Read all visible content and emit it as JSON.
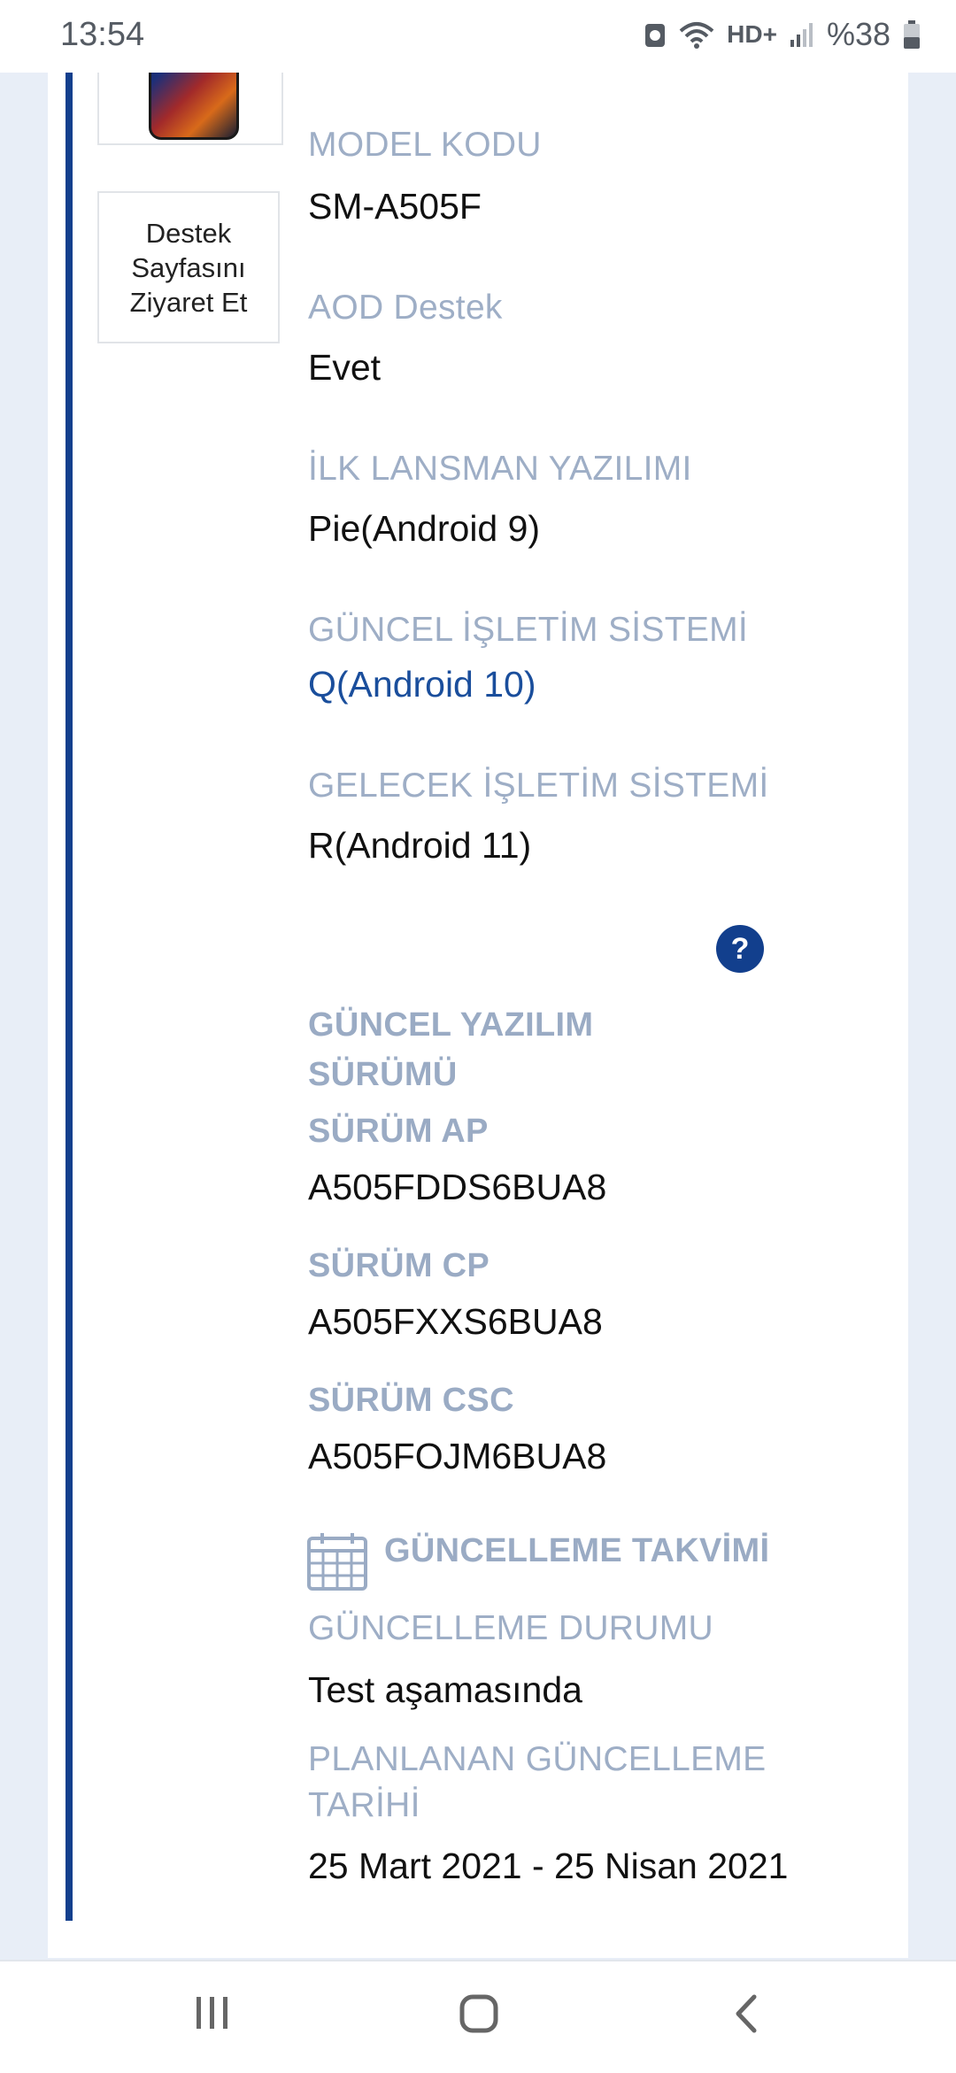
{
  "status_bar": {
    "time": "13:54",
    "network": "HD+",
    "battery": "%38",
    "icons": [
      "notification-icon",
      "wifi-icon",
      "signal-icon",
      "battery-icon"
    ]
  },
  "product": {
    "support_link": "Destek Sayfasını Ziyaret Et"
  },
  "info": {
    "model_code_label": "MODEL KODU",
    "model_code": "SM-A505F",
    "aod_label": "AOD Destek",
    "aod_value": "Evet",
    "first_launch_label": "İLK LANSMAN YAZILIMI",
    "first_launch_value": "Pie(Android 9)",
    "current_os_label": "GÜNCEL İŞLETİM SİSTEMİ",
    "current_os_value": "Q(Android 10)",
    "future_os_label": "GELECEK İŞLETİM SİSTEMİ",
    "future_os_value": "R(Android 11)"
  },
  "software": {
    "title": "GÜNCEL YAZILIM SÜRÜMÜ",
    "help": "?",
    "ap_label": "SÜRÜM AP",
    "ap_value": "A505FDDS6BUA8",
    "cp_label": "SÜRÜM CP",
    "cp_value": "A505FXXS6BUA8",
    "csc_label": "SÜRÜM CSC",
    "csc_value": "A505FOJM6BUA8"
  },
  "schedule": {
    "title": "GÜNCELLEME TAKVİMİ",
    "status_label": "GÜNCELLEME DURUMU",
    "status_value": "Test aşamasında",
    "planned_label": "PLANLANAN GÜNCELLEME TARİHİ",
    "planned_value": "25 Mart 2021 - 25 Nisan 2021"
  },
  "colors": {
    "accent": "#123f8d",
    "label": "#9eaec6",
    "link_value": "#1a4e9c"
  }
}
